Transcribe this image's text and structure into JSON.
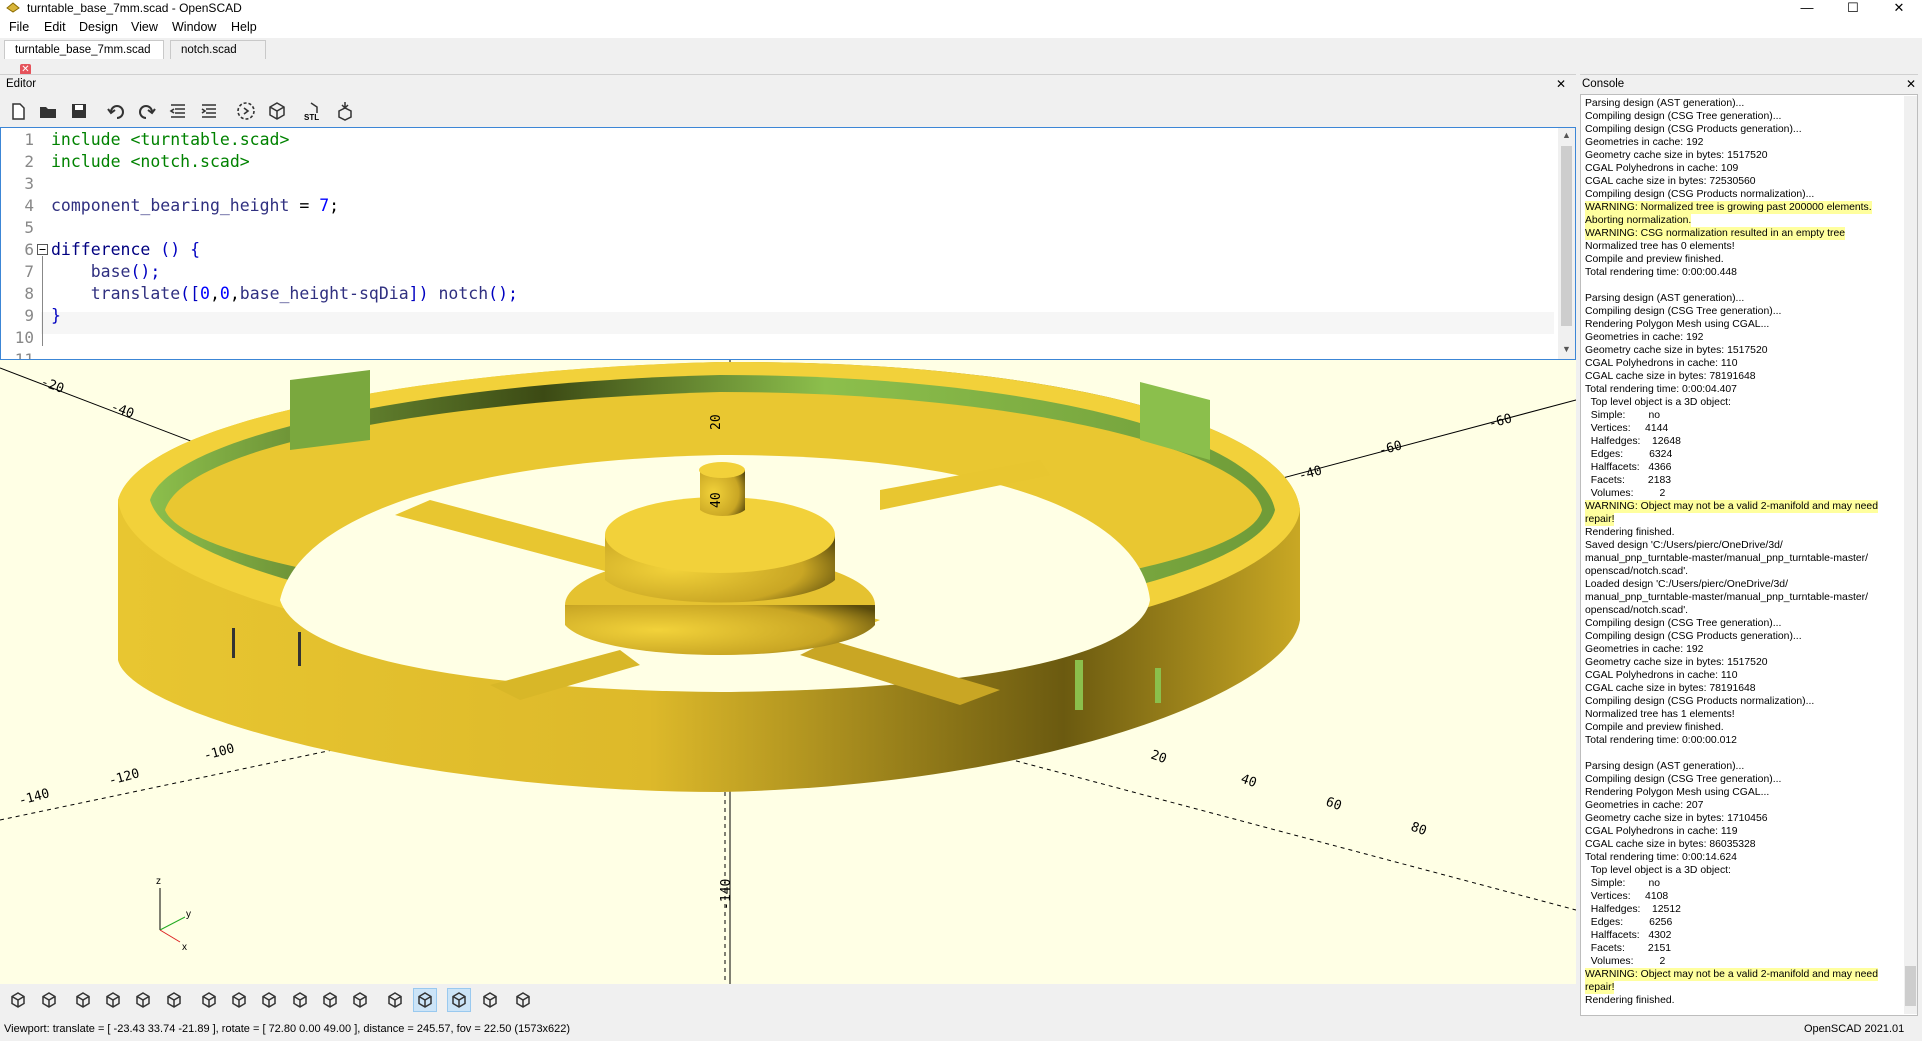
{
  "window": {
    "title": "turntable_base_7mm.scad - OpenSCAD",
    "controls": {
      "minimize": "—",
      "maximize": "☐",
      "close": "✕"
    }
  },
  "menu": [
    "File",
    "Edit",
    "Design",
    "View",
    "Window",
    "Help"
  ],
  "tabs": [
    {
      "label": "turntable_base_7mm.scad",
      "active": true
    },
    {
      "label": "notch.scad",
      "active": false
    }
  ],
  "editor": {
    "title": "Editor",
    "close": "✕",
    "toolbar_icons": [
      "new-file-icon",
      "open-file-icon",
      "save-icon",
      "undo-icon",
      "redo-icon",
      "unindent-icon",
      "indent-icon",
      "preview-icon",
      "render-icon",
      "export-stl-icon",
      "send-to-print-icon"
    ],
    "stl_label": "STL",
    "line_numbers": [
      "1",
      "2",
      "3",
      "4",
      "5",
      "6",
      "7",
      "8",
      "9",
      "10",
      "11"
    ],
    "lines": [
      [
        {
          "t": "include",
          "c": "kw"
        },
        {
          "t": " <turntable.scad>",
          "c": "str"
        }
      ],
      [
        {
          "t": "include",
          "c": "kw"
        },
        {
          "t": " <notch.scad>",
          "c": "str"
        }
      ],
      [],
      [
        {
          "t": "component_bearing_height",
          "c": "id"
        },
        {
          "t": " = ",
          "c": "op"
        },
        {
          "t": "7",
          "c": "num"
        },
        {
          "t": ";",
          "c": "op"
        }
      ],
      [],
      [
        {
          "t": "difference",
          "c": "fn"
        },
        {
          "t": " () {",
          "c": "br"
        }
      ],
      [
        {
          "t": "    base",
          "c": "id"
        },
        {
          "t": "();",
          "c": "br"
        }
      ],
      [
        {
          "t": "    translate",
          "c": "id"
        },
        {
          "t": "([",
          "c": "br"
        },
        {
          "t": "0",
          "c": "num"
        },
        {
          "t": ",",
          "c": "op"
        },
        {
          "t": "0",
          "c": "num"
        },
        {
          "t": ",",
          "c": "op"
        },
        {
          "t": "base_height-sqDia",
          "c": "id"
        },
        {
          "t": "])",
          "c": "br"
        },
        {
          "t": " notch",
          "c": "id"
        },
        {
          "t": "();",
          "c": "br"
        }
      ],
      [
        {
          "t": "}",
          "c": "br"
        }
      ],
      [],
      []
    ]
  },
  "viewport": {
    "axis_labels": [
      "-20",
      "-40",
      "-60",
      "20",
      "40",
      "60",
      "80",
      "20",
      "40",
      "-140",
      "-120",
      "-100",
      "20",
      "40",
      "60",
      "80",
      "-140"
    ],
    "axis_gizmo": {
      "x": "x",
      "y": "y",
      "z": "z"
    }
  },
  "view_toolbar_icons": [
    "preview-icon",
    "render-icon",
    "view-all-icon",
    "zoom-in-icon",
    "zoom-out-icon",
    "reset-view-icon",
    "right-view-icon",
    "top-view-icon",
    "bottom-view-icon",
    "left-view-icon",
    "front-view-icon",
    "back-view-icon",
    "perspective-icon",
    "orthogonal-icon",
    "show-axes-icon",
    "show-scale-markers-icon",
    "show-edges-icon"
  ],
  "status": {
    "viewport": "Viewport: translate = [ -23.43 33.74 -21.89 ], rotate = [ 72.80 0.00 49.00 ], distance = 245.57, fov = 22.50 (1573x622)",
    "version": "OpenSCAD 2021.01"
  },
  "console": {
    "title": "Console",
    "close": "✕",
    "lines": [
      {
        "t": "Parsing design (AST generation)...",
        "w": false
      },
      {
        "t": "Compiling design (CSG Tree generation)...",
        "w": false
      },
      {
        "t": "Compiling design (CSG Products generation)...",
        "w": false
      },
      {
        "t": "Geometries in cache: 192",
        "w": false
      },
      {
        "t": "Geometry cache size in bytes: 1517520",
        "w": false
      },
      {
        "t": "CGAL Polyhedrons in cache: 109",
        "w": false
      },
      {
        "t": "CGAL cache size in bytes: 72530560",
        "w": false
      },
      {
        "t": "Compiling design (CSG Products normalization)...",
        "w": false
      },
      {
        "t": "WARNING: Normalized tree is growing past 200000 elements.",
        "w": true
      },
      {
        "t": "Aborting normalization.",
        "w": true
      },
      {
        "t": "WARNING: CSG normalization resulted in an empty tree",
        "w": true
      },
      {
        "t": "Normalized tree has 0 elements!",
        "w": false
      },
      {
        "t": "Compile and preview finished.",
        "w": false
      },
      {
        "t": "Total rendering time: 0:00:00.448",
        "w": false
      },
      {
        "t": "",
        "w": false
      },
      {
        "t": "Parsing design (AST generation)...",
        "w": false
      },
      {
        "t": "Compiling design (CSG Tree generation)...",
        "w": false
      },
      {
        "t": "Rendering Polygon Mesh using CGAL...",
        "w": false
      },
      {
        "t": "Geometries in cache: 192",
        "w": false
      },
      {
        "t": "Geometry cache size in bytes: 1517520",
        "w": false
      },
      {
        "t": "CGAL Polyhedrons in cache: 110",
        "w": false
      },
      {
        "t": "CGAL cache size in bytes: 78191648",
        "w": false
      },
      {
        "t": "Total rendering time: 0:00:04.407",
        "w": false
      },
      {
        "t": "  Top level object is a 3D object:",
        "w": false
      },
      {
        "t": "  Simple:        no",
        "w": false
      },
      {
        "t": "  Vertices:     4144",
        "w": false
      },
      {
        "t": "  Halfedges:    12648",
        "w": false
      },
      {
        "t": "  Edges:         6324",
        "w": false
      },
      {
        "t": "  Halffacets:   4366",
        "w": false
      },
      {
        "t": "  Facets:        2183",
        "w": false
      },
      {
        "t": "  Volumes:         2",
        "w": false
      },
      {
        "t": "WARNING: Object may not be a valid 2-manifold and may need",
        "w": true
      },
      {
        "t": "repair!",
        "w": true
      },
      {
        "t": "Rendering finished.",
        "w": false
      },
      {
        "t": "Saved design 'C:/Users/pierc/OneDrive/3d/",
        "w": false
      },
      {
        "t": "manual_pnp_turntable-master/manual_pnp_turntable-master/",
        "w": false
      },
      {
        "t": "openscad/notch.scad'.",
        "w": false
      },
      {
        "t": "Loaded design 'C:/Users/pierc/OneDrive/3d/",
        "w": false
      },
      {
        "t": "manual_pnp_turntable-master/manual_pnp_turntable-master/",
        "w": false
      },
      {
        "t": "openscad/notch.scad'.",
        "w": false
      },
      {
        "t": "Compiling design (CSG Tree generation)...",
        "w": false
      },
      {
        "t": "Compiling design (CSG Products generation)...",
        "w": false
      },
      {
        "t": "Geometries in cache: 192",
        "w": false
      },
      {
        "t": "Geometry cache size in bytes: 1517520",
        "w": false
      },
      {
        "t": "CGAL Polyhedrons in cache: 110",
        "w": false
      },
      {
        "t": "CGAL cache size in bytes: 78191648",
        "w": false
      },
      {
        "t": "Compiling design (CSG Products normalization)...",
        "w": false
      },
      {
        "t": "Normalized tree has 1 elements!",
        "w": false
      },
      {
        "t": "Compile and preview finished.",
        "w": false
      },
      {
        "t": "Total rendering time: 0:00:00.012",
        "w": false
      },
      {
        "t": "",
        "w": false
      },
      {
        "t": "Parsing design (AST generation)...",
        "w": false
      },
      {
        "t": "Compiling design (CSG Tree generation)...",
        "w": false
      },
      {
        "t": "Rendering Polygon Mesh using CGAL...",
        "w": false
      },
      {
        "t": "Geometries in cache: 207",
        "w": false
      },
      {
        "t": "Geometry cache size in bytes: 1710456",
        "w": false
      },
      {
        "t": "CGAL Polyhedrons in cache: 119",
        "w": false
      },
      {
        "t": "CGAL cache size in bytes: 86035328",
        "w": false
      },
      {
        "t": "Total rendering time: 0:00:14.624",
        "w": false
      },
      {
        "t": "  Top level object is a 3D object:",
        "w": false
      },
      {
        "t": "  Simple:        no",
        "w": false
      },
      {
        "t": "  Vertices:     4108",
        "w": false
      },
      {
        "t": "  Halfedges:    12512",
        "w": false
      },
      {
        "t": "  Edges:         6256",
        "w": false
      },
      {
        "t": "  Halffacets:   4302",
        "w": false
      },
      {
        "t": "  Facets:        2151",
        "w": false
      },
      {
        "t": "  Volumes:         2",
        "w": false
      },
      {
        "t": "WARNING: Object may not be a valid 2-manifold and may need",
        "w": true
      },
      {
        "t": "repair!",
        "w": true
      },
      {
        "t": "Rendering finished.",
        "w": false
      }
    ]
  },
  "colors": {
    "model_yellow": "#f0d034",
    "model_green": "#8bbf4c",
    "viewport_bg": "#ffffe5",
    "warning_bg": "#ffff9e",
    "focus_border": "#3c86d6"
  }
}
